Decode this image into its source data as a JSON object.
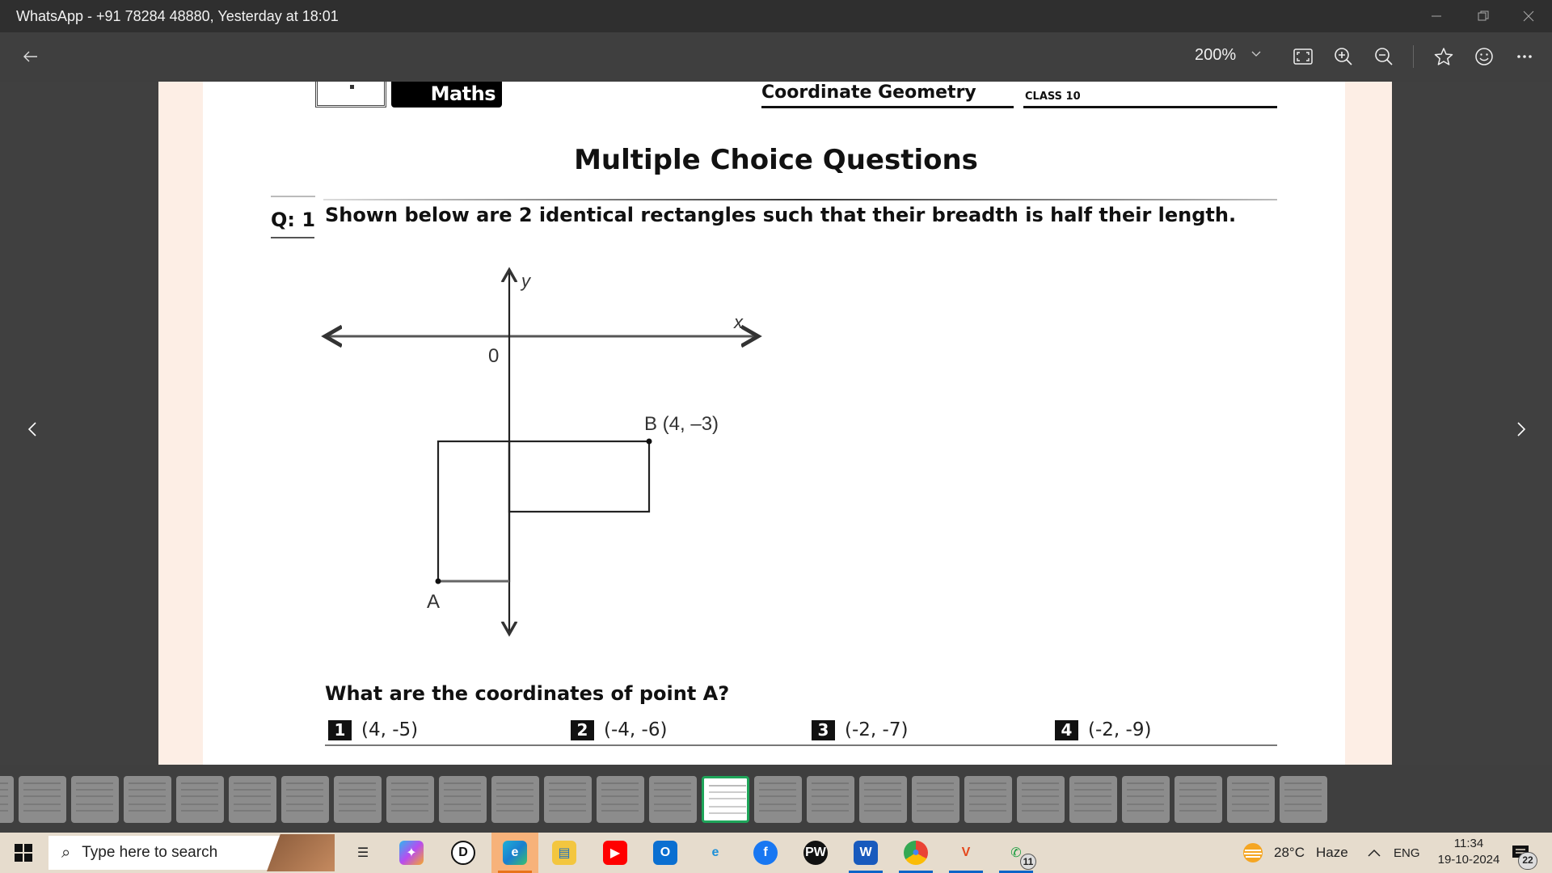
{
  "window": {
    "title": "WhatsApp - +91 78284 48880, Yesterday at 18:01",
    "controls": {
      "minimize": "minimize",
      "restore": "restore",
      "close": "close"
    }
  },
  "toolbar": {
    "back_icon": "arrow-left-icon",
    "zoom_level": "200%",
    "zoom_dropdown_icon": "chevron-down-icon",
    "icons": [
      "fit-to-screen-icon",
      "zoom-in-icon",
      "zoom-out-icon",
      "star-icon",
      "emoji-icon",
      "more-icon"
    ]
  },
  "viewer": {
    "prev_icon": "chevron-left-icon",
    "next_icon": "chevron-right-icon"
  },
  "document": {
    "subject_tag": "Maths",
    "topic": "Coordinate Geometry",
    "class_label": "CLASS 10",
    "section_title": "Multiple Choice Questions",
    "question_number": "Q: 1",
    "question_text": "Shown below are 2 identical rectangles such that their breadth is half their length.",
    "diagram": {
      "y_axis_label": "y",
      "x_axis_label": "x",
      "origin_label": "0",
      "point_b_label": "B (4, –3)",
      "point_a_label": "A"
    },
    "prompt": "What are the coordinates of point A?",
    "options": [
      {
        "num": "1",
        "text": "(4, -5)"
      },
      {
        "num": "2",
        "text": "(-4, -6)"
      },
      {
        "num": "3",
        "text": "(-2, -7)"
      },
      {
        "num": "4",
        "text": "(-2, -9)"
      }
    ]
  },
  "thumbnails": {
    "count": 26,
    "active_index": 14
  },
  "taskbar": {
    "search_placeholder": "Type here to search",
    "apps": [
      {
        "name": "task-view",
        "glyph": "☰"
      },
      {
        "name": "copilot",
        "glyph": "✦"
      },
      {
        "name": "dell",
        "glyph": "D"
      },
      {
        "name": "edge",
        "glyph": "e"
      },
      {
        "name": "file-explorer",
        "glyph": "▤"
      },
      {
        "name": "youtube",
        "glyph": "▶"
      },
      {
        "name": "outlook",
        "glyph": "O"
      },
      {
        "name": "internet-explorer",
        "glyph": "e"
      },
      {
        "name": "facebook",
        "glyph": "f"
      },
      {
        "name": "physics-wallah",
        "glyph": "PW"
      },
      {
        "name": "word",
        "glyph": "W"
      },
      {
        "name": "chrome",
        "glyph": "●"
      },
      {
        "name": "vidmate",
        "glyph": "V"
      },
      {
        "name": "whatsapp",
        "glyph": "✆"
      }
    ],
    "whatsapp_badge": "11",
    "weather_temp": "28°C",
    "weather_desc": "Haze",
    "language": "ENG",
    "time": "11:34",
    "date": "19-10-2024",
    "notification_count": "22"
  }
}
